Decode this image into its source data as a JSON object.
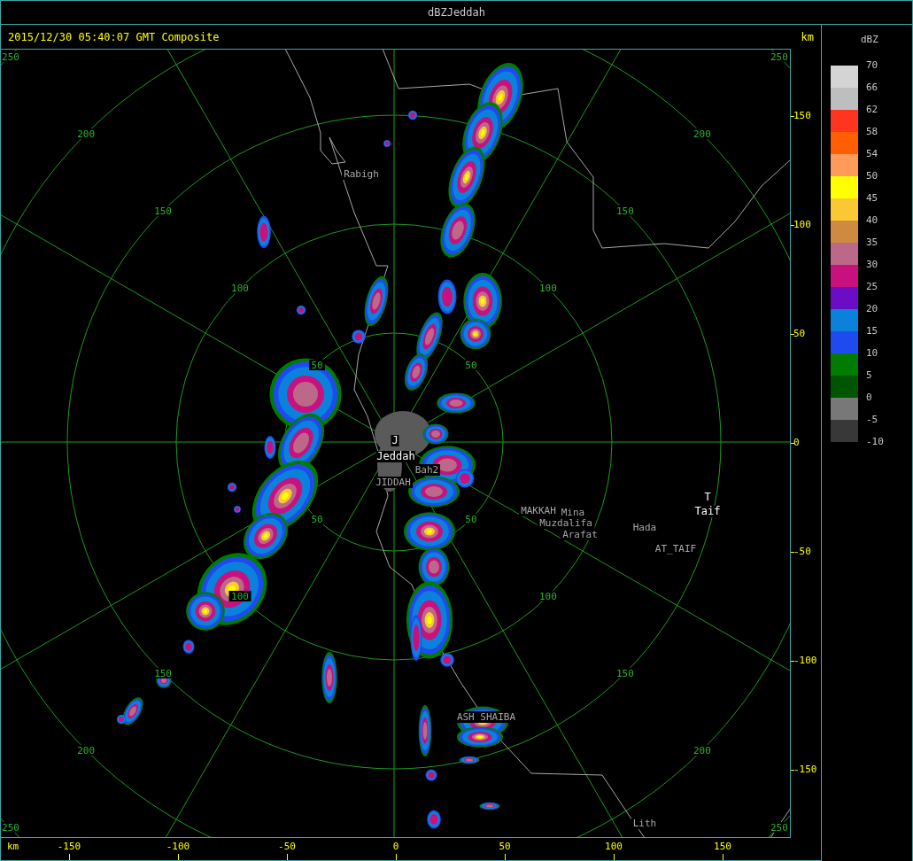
{
  "window": {
    "title": "dBZJeddah"
  },
  "header": {
    "timestamp": "2015/12/30 05:40:07 GMT Composite",
    "unit": "km"
  },
  "radar_map": {
    "range_rings": [
      {
        "labels": [
          "50",
          "50",
          "50",
          "50"
        ]
      },
      {
        "labels": [
          "100",
          "100",
          "100",
          "100"
        ]
      },
      {
        "labels": [
          "150",
          "150",
          "150",
          "150"
        ]
      },
      {
        "labels": [
          "200",
          "200",
          "200",
          "200"
        ]
      },
      {
        "labels": [
          "250",
          "250",
          "250",
          "250"
        ]
      }
    ],
    "places": [
      {
        "name": "Rabigh",
        "kind": "place"
      },
      {
        "name": "J",
        "kind": "station"
      },
      {
        "name": "Jeddah",
        "kind": "station"
      },
      {
        "name": "Bah2",
        "kind": "place"
      },
      {
        "name": "JIDDAH",
        "kind": "place"
      },
      {
        "name": "MAKKAH",
        "kind": "place"
      },
      {
        "name": "Mina",
        "kind": "place"
      },
      {
        "name": "Muzdalifa",
        "kind": "place"
      },
      {
        "name": "Arafat",
        "kind": "place"
      },
      {
        "name": "Hada",
        "kind": "place"
      },
      {
        "name": "AT_TAIF",
        "kind": "place"
      },
      {
        "name": "T",
        "kind": "station"
      },
      {
        "name": "Taif",
        "kind": "station"
      },
      {
        "name": "ASH SHAIBA",
        "kind": "place"
      },
      {
        "name": "Lith",
        "kind": "place"
      }
    ]
  },
  "y_axis": {
    "ticks": [
      "150",
      "100",
      "50",
      "0",
      "-50",
      "-100",
      "-150"
    ]
  },
  "x_axis": {
    "unit": "km",
    "ticks": [
      "-150",
      "-100",
      "-50",
      "0",
      "50",
      "100",
      "150"
    ]
  },
  "legend": {
    "title": "dBZ",
    "scale_labels": [
      "70",
      "66",
      "62",
      "58",
      "54",
      "50",
      "45",
      "40",
      "35",
      "30",
      "25",
      "20",
      "15",
      "10",
      "5",
      "0",
      "-5",
      "-10"
    ],
    "swatches": [
      {
        "color": "#d4d4d4"
      },
      {
        "color": "#bebebe"
      },
      {
        "color": "#ff3520"
      },
      {
        "color": "#ff5f00"
      },
      {
        "color": "#ff9b5a"
      },
      {
        "color": "#ffff00"
      },
      {
        "color": "#fac832"
      },
      {
        "color": "#cd8a40"
      },
      {
        "color": "#bc6888"
      },
      {
        "color": "#c8107e"
      },
      {
        "color": "#6c0dc6"
      },
      {
        "color": "#0a82dc"
      },
      {
        "color": "#1e4af0"
      },
      {
        "color": "#007d00"
      },
      {
        "color": "#005500"
      },
      {
        "color": "#787878"
      },
      {
        "color": "#383838"
      }
    ]
  }
}
